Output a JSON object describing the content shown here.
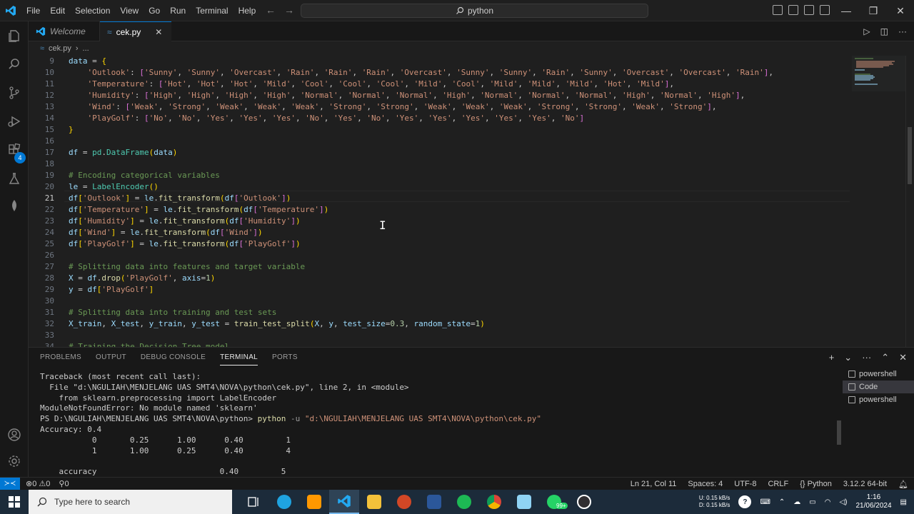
{
  "window": {
    "menu": [
      "File",
      "Edit",
      "Selection",
      "View",
      "Go",
      "Run",
      "Terminal",
      "Help"
    ],
    "search": "python"
  },
  "tabs": [
    {
      "label": "Welcome"
    },
    {
      "label": "cek.py"
    }
  ],
  "breadcrumb": {
    "file": "cek.py",
    "rest": "..."
  },
  "editor": {
    "line_numbers": [
      "9",
      "10",
      "11",
      "12",
      "13",
      "14",
      "15",
      "16",
      "17",
      "18",
      "19",
      "20",
      "21",
      "22",
      "23",
      "24",
      "25",
      "26",
      "27",
      "28",
      "29",
      "30",
      "31",
      "32",
      "33",
      "34"
    ],
    "current_line": "21"
  },
  "panel": {
    "tabs": [
      "PROBLEMS",
      "OUTPUT",
      "DEBUG CONSOLE",
      "TERMINAL",
      "PORTS"
    ],
    "terminal_lines": [
      "Traceback (most recent call last):",
      "  File \"d:\\NGULIAH\\MENJELANG UAS SMT4\\NOVA\\python\\cek.py\", line 2, in <module>",
      "    from sklearn.preprocessing import LabelEncoder",
      "ModuleNotFoundError: No module named 'sklearn'"
    ],
    "prompt": "PS D:\\NGULIAH\\MENJELANG UAS SMT4\\NOVA\\python> ",
    "cmd": "python",
    "flag": "-u",
    "path_arg": "\"d:\\NGULIAH\\MENJELANG UAS SMT4\\NOVA\\python\\cek.py\"",
    "output_lines": [
      "Accuracy: 0.4",
      "           0       0.25      1.00      0.40         1",
      "           1       1.00      0.25      0.40         4",
      "",
      "    accuracy                          0.40         5"
    ],
    "terminals": [
      "powershell",
      "Code",
      "powershell"
    ]
  },
  "statusbar": {
    "errors": "0",
    "warnings": "0",
    "ports": "0",
    "position": "Ln 21, Col 11",
    "spaces": "Spaces: 4",
    "encoding": "UTF-8",
    "eol": "CRLF",
    "language": "Python",
    "interpreter": "3.12.2 64-bit"
  },
  "taskbar": {
    "search_placeholder": "Type here to search",
    "net_up": "0.15 kB/s",
    "net_down": "0.15 kB/s",
    "net_up_label": "U:",
    "net_down_label": "D:",
    "time": "1:16",
    "date": "21/06/2024",
    "whatsapp_badge": "99+"
  }
}
